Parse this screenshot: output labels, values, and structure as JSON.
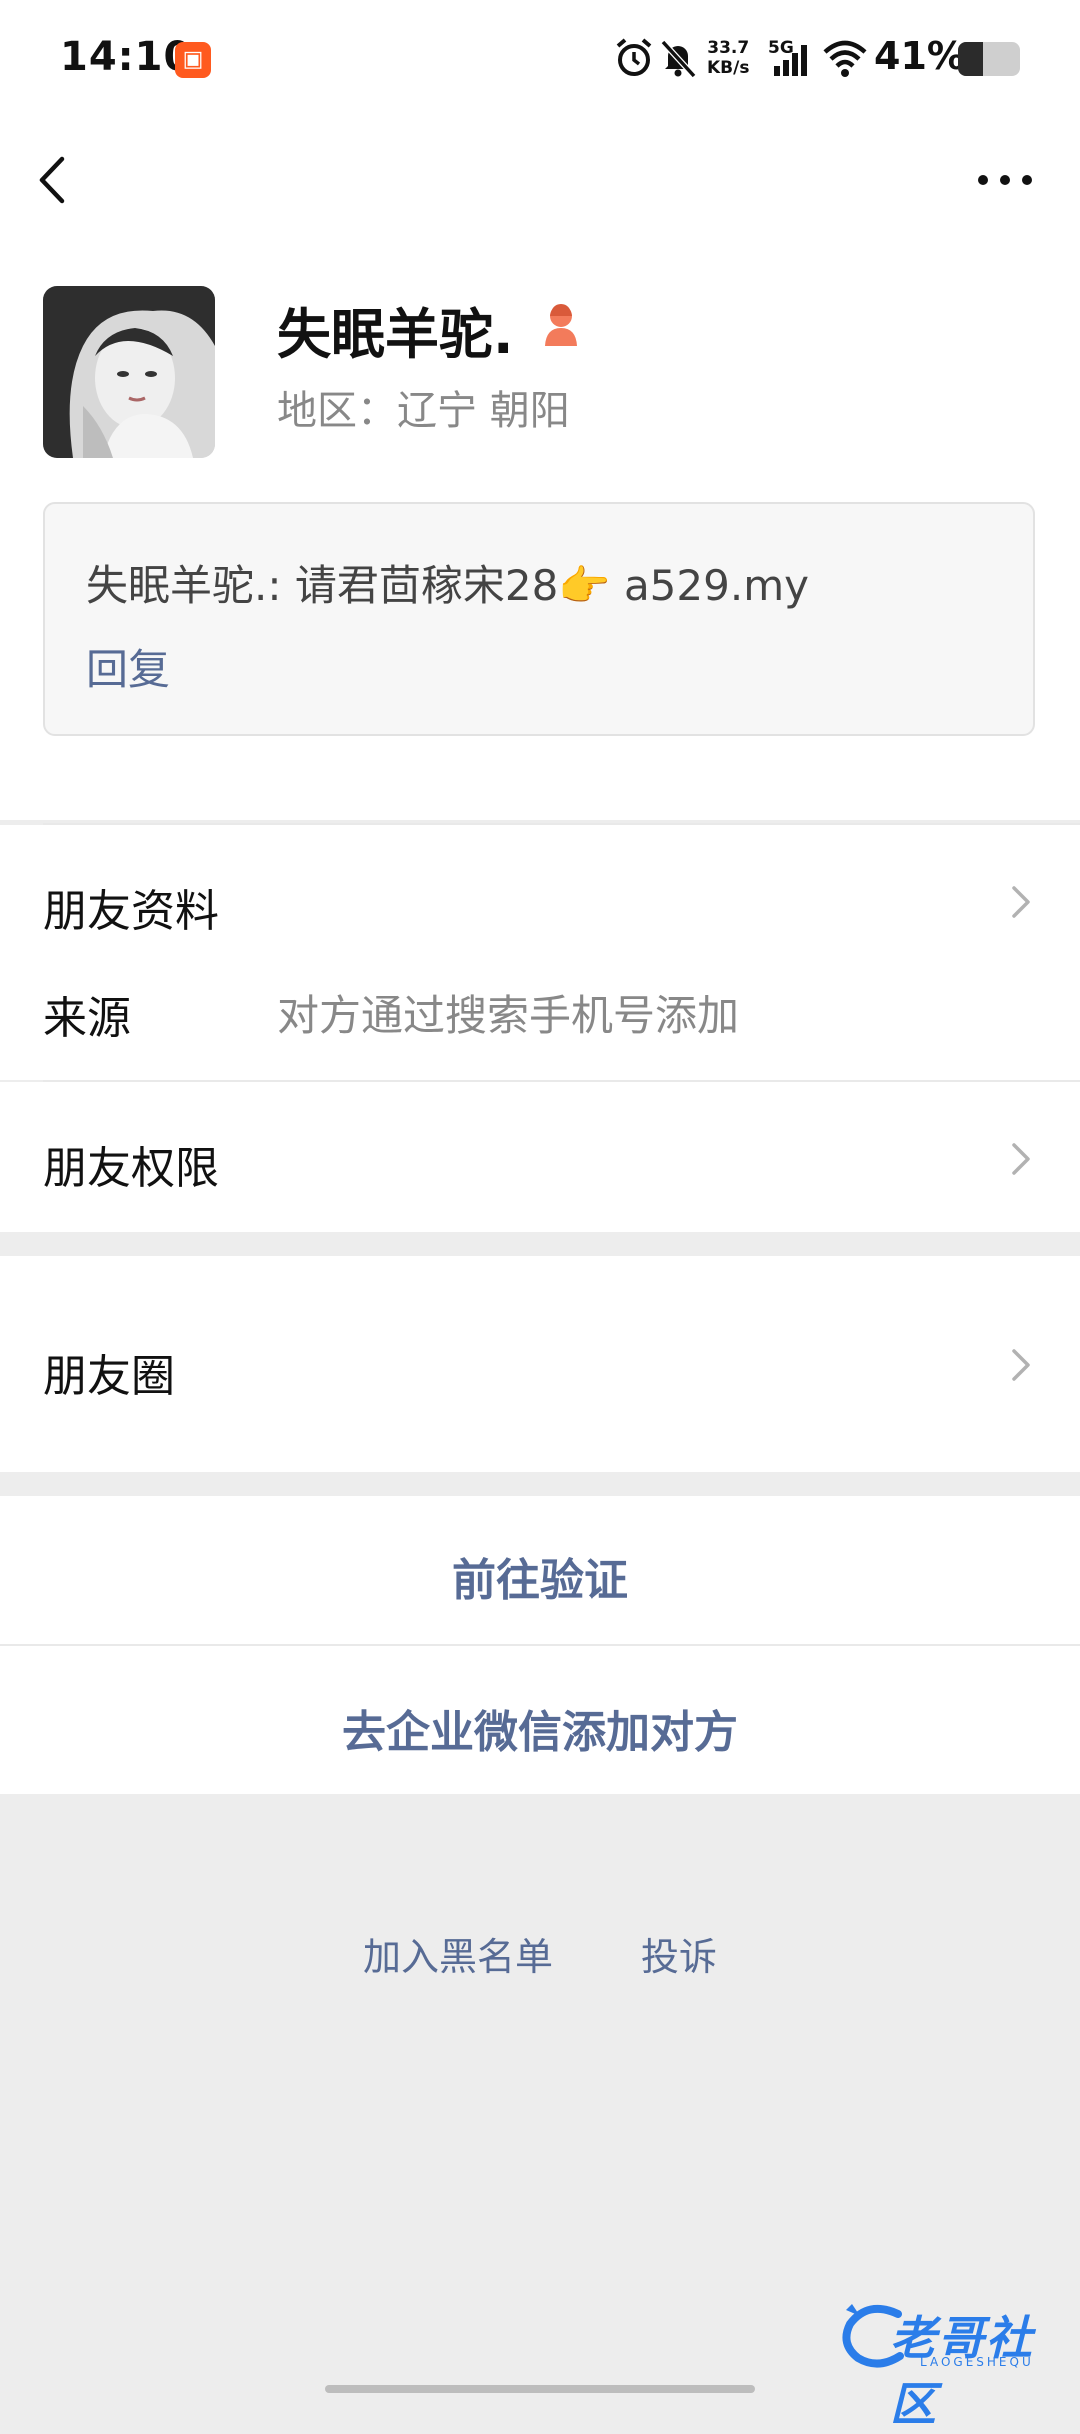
{
  "status_bar": {
    "time": "14:10",
    "app_badge_icon": "app-badge-icon",
    "net_speed_value": "33.7",
    "net_speed_unit": "KB/s",
    "network_type": "5G",
    "battery_percent_text": "41%",
    "battery_level": 0.41
  },
  "nav": {
    "back_icon": "chevron-left-icon",
    "more_icon": "more-dots-icon"
  },
  "profile": {
    "name": "失眠羊驼.",
    "gender_icon": "female-icon",
    "gender_color": "#f37b5b",
    "region": "地区：辽宁  朝阳",
    "message": "失眠羊驼.: 请君茴稼宋28👉 a529.my",
    "reply_label": "回复"
  },
  "rows": {
    "friend_info_label": "朋友资料",
    "source_label": "来源",
    "source_value": "对方通过搜索手机号添加",
    "permissions_label": "朋友权限",
    "moments_label": "朋友圈"
  },
  "actions": {
    "verify_label": "前往验证",
    "wecom_add_label": "去企业微信添加对方"
  },
  "footer": {
    "blacklist_label": "加入黑名单",
    "report_label": "投诉"
  },
  "watermark": {
    "text": "老哥社区",
    "subtext": "LAOGESHEQU"
  },
  "colors": {
    "link_blue": "#576b95",
    "background_gray": "#ededed"
  }
}
